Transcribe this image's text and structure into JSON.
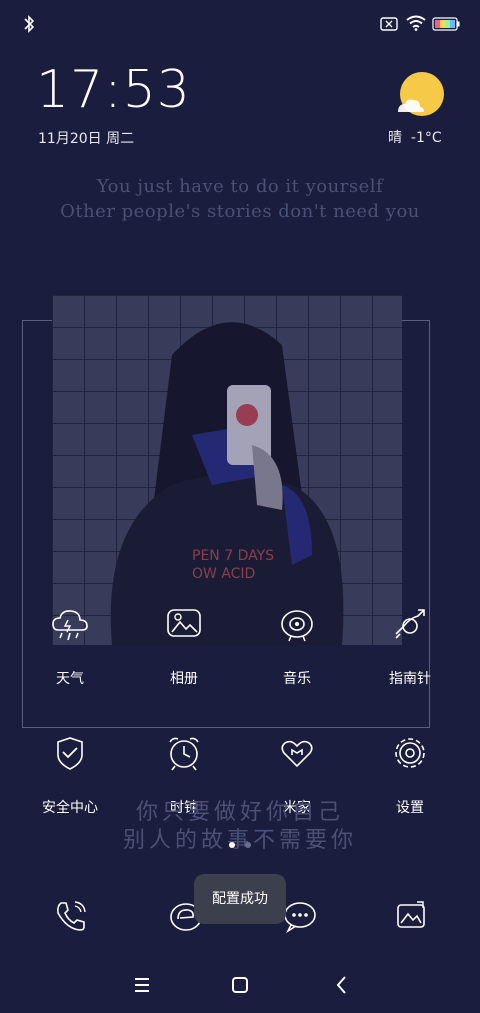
{
  "status_bar": {
    "icons": [
      "bluetooth-icon",
      "no-sim-icon",
      "wifi-icon",
      "battery-icon"
    ],
    "battery_colors": [
      "#ff5b7a",
      "#ffd45b",
      "#7dff9c",
      "#6fb6ff"
    ]
  },
  "clock": {
    "time": "17:53",
    "date": "11月20日 周二"
  },
  "weather": {
    "icon": "sun-cloud-icon",
    "text": "晴  -1°C",
    "sun_color": "#f7c948"
  },
  "quote_en": {
    "line1": "You just have to do it yourself",
    "line2": "Other people's stories don't need you"
  },
  "quote_cn": {
    "line1": "你只要做好你自己",
    "line2": "别人的故事不需要你"
  },
  "apps_row1": [
    {
      "label": "天气",
      "icon": "weather-icon"
    },
    {
      "label": "相册",
      "icon": "gallery-icon"
    },
    {
      "label": "音乐",
      "icon": "music-icon"
    },
    {
      "label": "指南针",
      "icon": "compass-icon"
    }
  ],
  "apps_row2": [
    {
      "label": "安全中心",
      "icon": "shield-icon"
    },
    {
      "label": "时钟",
      "icon": "alarm-clock-icon"
    },
    {
      "label": "米家",
      "icon": "heart-home-icon"
    },
    {
      "label": "设置",
      "icon": "gear-icon"
    }
  ],
  "page_indicator": {
    "pages": 2,
    "active": 1
  },
  "toast": {
    "text": "配置成功"
  },
  "dock": [
    {
      "icon": "phone-icon"
    },
    {
      "icon": "browser-icon"
    },
    {
      "icon": "message-icon"
    },
    {
      "icon": "camera-icon"
    }
  ],
  "nav_bar": [
    "menu-icon",
    "home-icon",
    "back-icon"
  ]
}
